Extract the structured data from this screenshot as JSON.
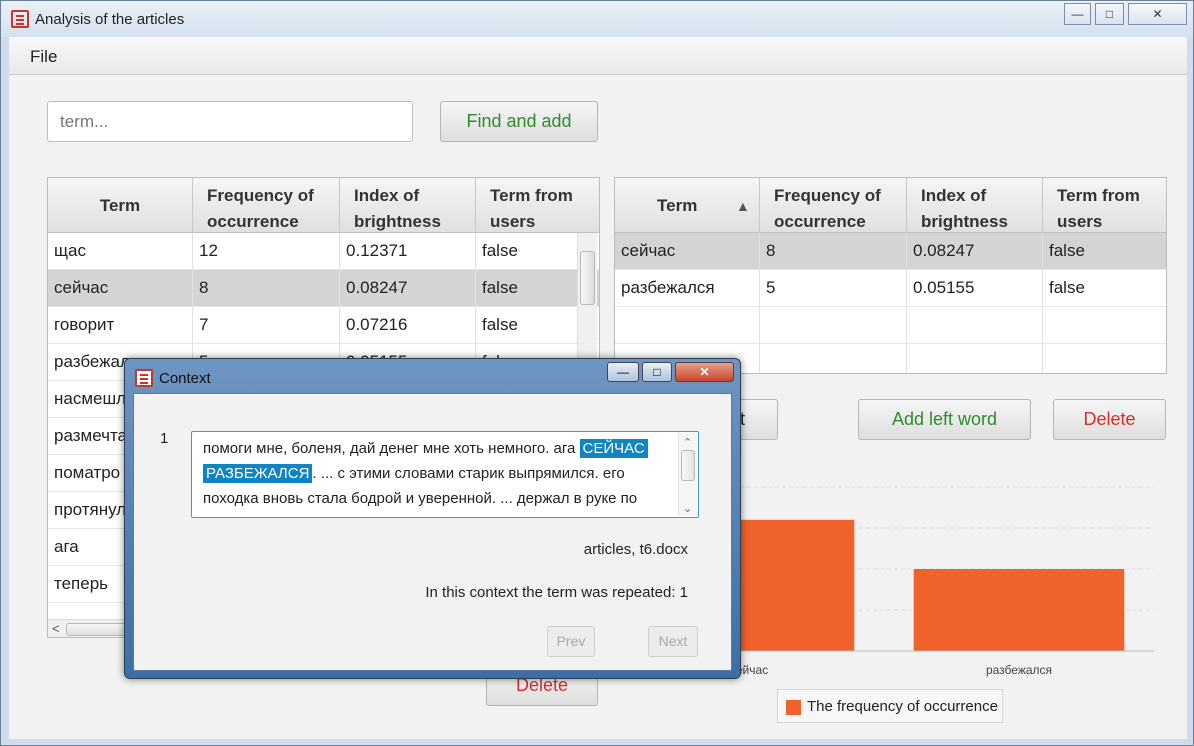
{
  "window": {
    "title": "Analysis of the articles",
    "minimize": "—",
    "maximize": "□",
    "close": "✕"
  },
  "menu": {
    "file": "File"
  },
  "search": {
    "placeholder": "term...",
    "find_button": "Find and add"
  },
  "left_table": {
    "headers": [
      "Term",
      "Frequency of occurrence",
      "Index of brightness",
      "Term from users"
    ],
    "rows": [
      [
        "щас",
        "12",
        "0.12371",
        "false"
      ],
      [
        "сейчас",
        "8",
        "0.08247",
        "false"
      ],
      [
        "говорит",
        "7",
        "0.07216",
        "false"
      ],
      [
        "разбежался",
        "5",
        "0.05155",
        "false"
      ],
      [
        "насмешл",
        "",
        "",
        ""
      ],
      [
        "размечта",
        "",
        "",
        ""
      ],
      [
        "поматро",
        "",
        "",
        ""
      ],
      [
        "протянул",
        "",
        "",
        ""
      ],
      [
        "ага",
        "",
        "",
        ""
      ],
      [
        "теперь",
        "",
        "",
        ""
      ]
    ],
    "delete_button": "Delete"
  },
  "right_table": {
    "headers": [
      "Term",
      "Frequency of occurrence",
      "Index of brightness",
      "Term from users"
    ],
    "sort_indicator": "▲",
    "rows": [
      [
        "сейчас",
        "8",
        "0.08247",
        "false"
      ],
      [
        "разбежался",
        "5",
        "0.05155",
        "false"
      ]
    ],
    "context_button": "Context",
    "add_left_word_button": "Add left word",
    "delete_button": "Delete"
  },
  "chart_data": {
    "type": "bar",
    "categories": [
      "сейчас",
      "разбежался"
    ],
    "series": [
      {
        "name": "The frequency of occurrence",
        "values": [
          8,
          5
        ],
        "color": "#f0622c"
      }
    ],
    "legend_placement": "bottom"
  },
  "dialog": {
    "title": "Context",
    "index": "1",
    "text_before": "помоги мне, боленя, дай денег мне хоть немного. ага ",
    "highlight_1": "СЕЙЧАС",
    "highlight_2": "РАЗБЕЖАЛСЯ",
    "text_after": ". ... с этими словами старик выпрямился. его походка вновь стала бодрой и уверенной. ... держал в руке по",
    "source": "articles, t6.docx",
    "repeated": "In this context the term was repeated: 1",
    "prev": "Prev",
    "next": "Next"
  }
}
